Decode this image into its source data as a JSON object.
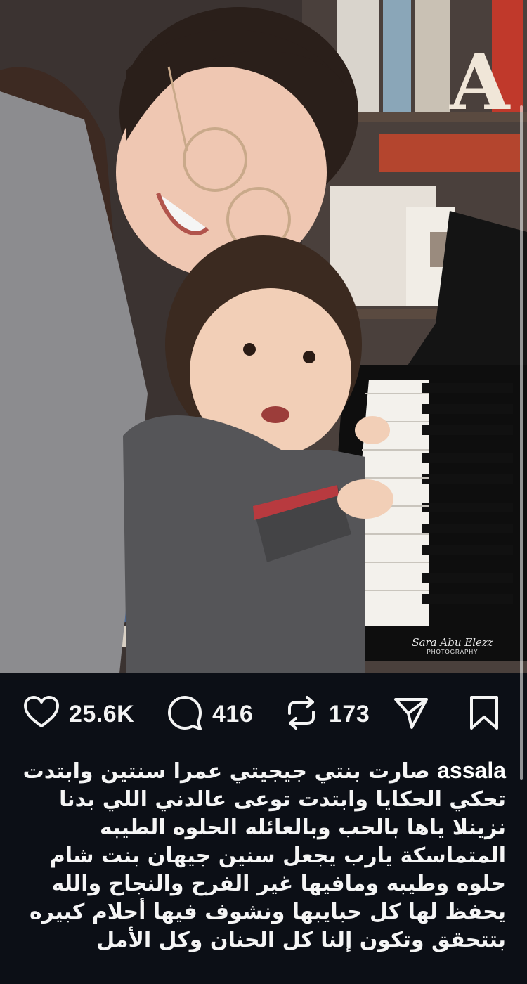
{
  "post": {
    "watermark_line1": "Sara Abu Elezz",
    "watermark_line2": "PHOTOGRAPHY"
  },
  "actions": {
    "likes": "25.6K",
    "comments": "416",
    "reposts": "173"
  },
  "caption": {
    "username": "assala",
    "text": "صارت بنتي جيجيتي عمرا سنتين وابتدت تحكي الحكايا وابتدت توعى عالدني اللي بدنا نزينلا ياها بالحب وبالعائله الحلوه الطيبه المتماسكة يارب يجعل سنين جيهان بنت شام حلوه وطيبه ومافيها غير الفرح والنجاح والله يحفظ لها كل حبايبها ونشوف فيها أحلام كبيره بتتحقق وتكون إلنا كل الحنان وكل الأمل"
  },
  "colors": {
    "background": "#0c0f16",
    "text": "#f5f5f5"
  },
  "icons": [
    "heart-icon",
    "comment-icon",
    "repost-icon",
    "share-icon",
    "bookmark-icon"
  ]
}
